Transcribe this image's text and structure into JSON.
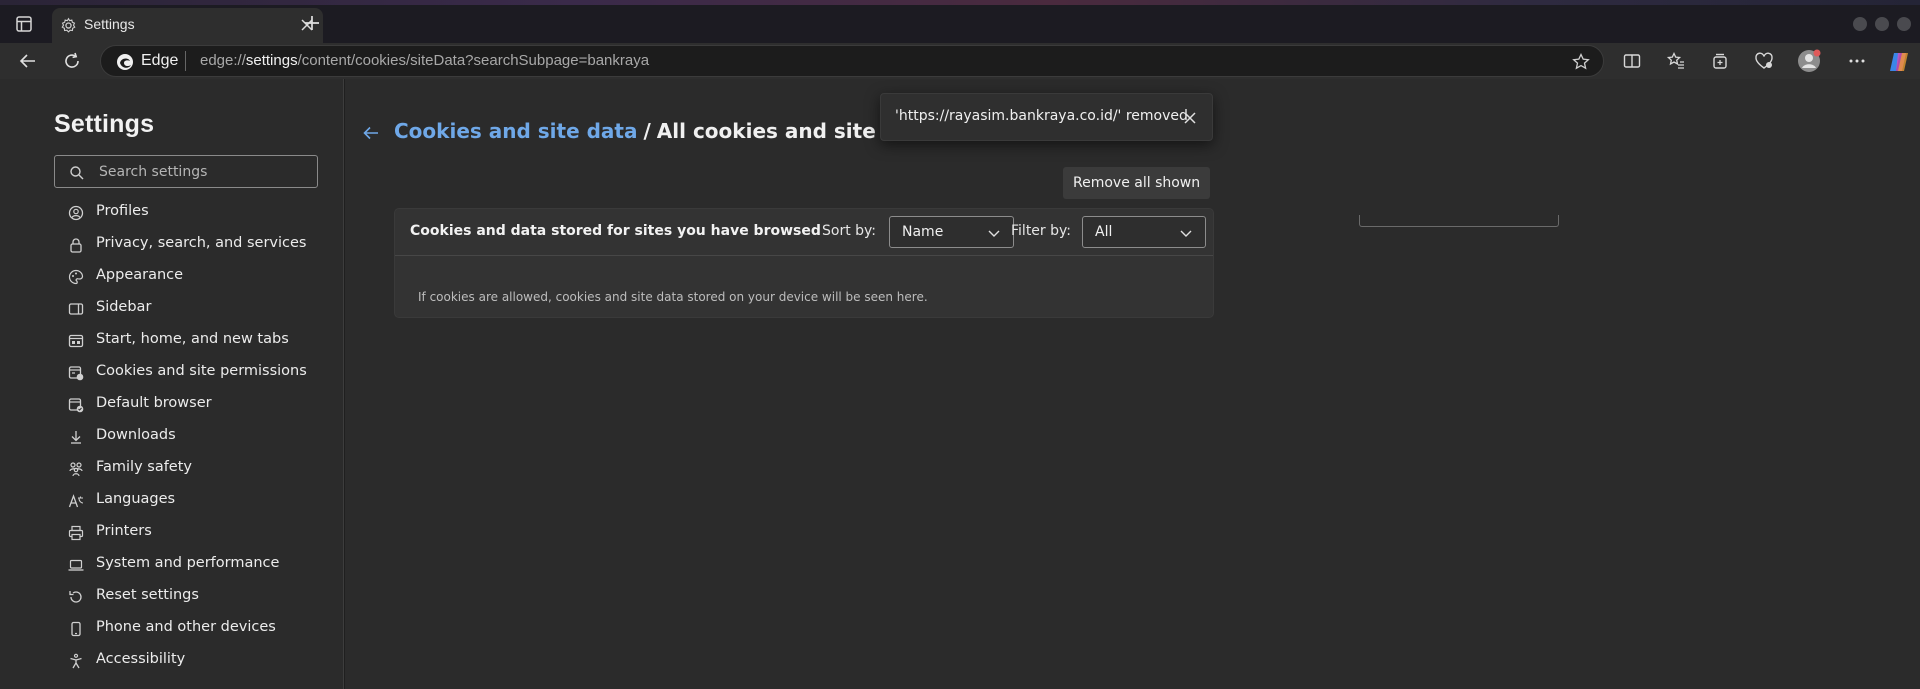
{
  "browser": {
    "tab": {
      "title": "Settings",
      "icon": "gear-icon"
    },
    "address_bar": {
      "brand": "Edge",
      "url_prefix": "edge://",
      "url_host": "settings",
      "url_path": "/content/cookies/siteData?searchSubpage=bankraya"
    }
  },
  "sidebar": {
    "title": "Settings",
    "search_placeholder": "Search settings",
    "items": [
      {
        "label": "Profiles",
        "icon": "profile-icon"
      },
      {
        "label": "Privacy, search, and services",
        "icon": "lock-icon"
      },
      {
        "label": "Appearance",
        "icon": "palette-icon"
      },
      {
        "label": "Sidebar",
        "icon": "sidebar-icon"
      },
      {
        "label": "Start, home, and new tabs",
        "icon": "home-tabs-icon"
      },
      {
        "label": "Cookies and site permissions",
        "icon": "cookies-icon"
      },
      {
        "label": "Default browser",
        "icon": "default-browser-icon"
      },
      {
        "label": "Downloads",
        "icon": "download-icon"
      },
      {
        "label": "Family safety",
        "icon": "family-icon"
      },
      {
        "label": "Languages",
        "icon": "language-icon"
      },
      {
        "label": "Printers",
        "icon": "printer-icon"
      },
      {
        "label": "System and performance",
        "icon": "laptop-icon"
      },
      {
        "label": "Reset settings",
        "icon": "reset-icon"
      },
      {
        "label": "Phone and other devices",
        "icon": "phone-icon"
      },
      {
        "label": "Accessibility",
        "icon": "accessibility-icon"
      }
    ]
  },
  "main": {
    "breadcrumb_parent": "Cookies and site data",
    "breadcrumb_separator": "/",
    "breadcrumb_current": "All cookies and site data",
    "remove_all_label": "Remove all shown",
    "card": {
      "title": "Cookies and data stored for sites you have browsed",
      "sort_label": "Sort by:",
      "sort_value": "Name",
      "filter_label": "Filter by:",
      "filter_value": "All",
      "empty_message": "If cookies are allowed, cookies and site data stored on your device will be seen here."
    }
  },
  "toast": {
    "message": "'https://rayasim.bankraya.co.id/' removed"
  },
  "colors": {
    "link": "#6fa8e8",
    "background": "#2b2b2b",
    "card": "#333333"
  }
}
